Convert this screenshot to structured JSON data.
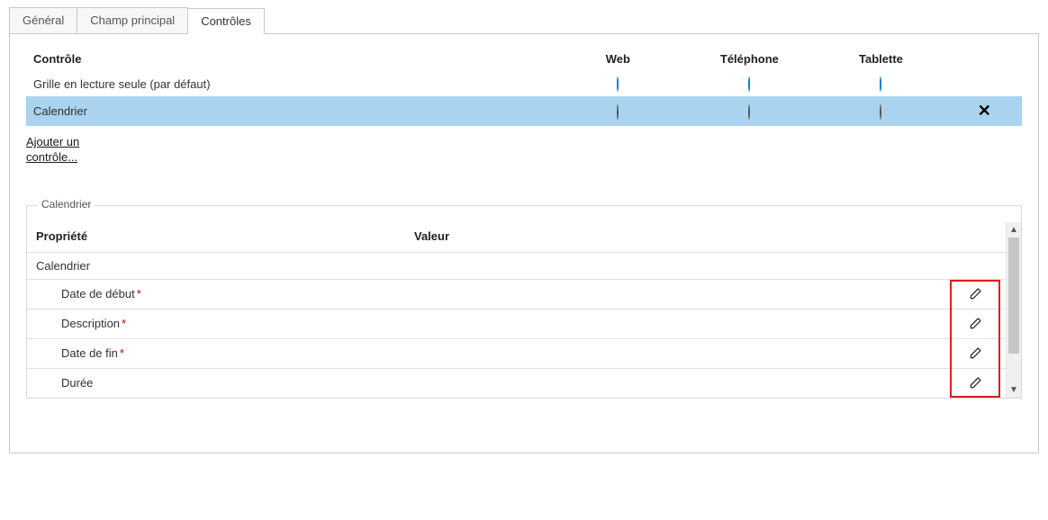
{
  "tabs": {
    "general": "Général",
    "main_field": "Champ principal",
    "controls": "Contrôles"
  },
  "controls_table": {
    "headers": {
      "control": "Contrôle",
      "web": "Web",
      "phone": "Téléphone",
      "tablet": "Tablette"
    },
    "rows": [
      {
        "label": "Grille en lecture seule (par défaut)",
        "web_checked": true,
        "phone_checked": true,
        "tablet_checked": true,
        "selected": false,
        "removable": false
      },
      {
        "label": "Calendrier",
        "web_checked": false,
        "phone_checked": false,
        "tablet_checked": false,
        "selected": true,
        "removable": true
      }
    ],
    "add_control_link": "Ajouter un\ncontrôle..."
  },
  "properties_panel": {
    "legend": "Calendrier",
    "headers": {
      "property": "Propriété",
      "value": "Valeur"
    },
    "group_label": "Calendrier",
    "properties": [
      {
        "label": "Date de début",
        "required": true,
        "has_edit": true
      },
      {
        "label": "Description",
        "required": true,
        "has_edit": true
      },
      {
        "label": "Date de fin",
        "required": true,
        "has_edit": true
      },
      {
        "label": "Durée",
        "required": false,
        "has_edit": true
      }
    ]
  }
}
